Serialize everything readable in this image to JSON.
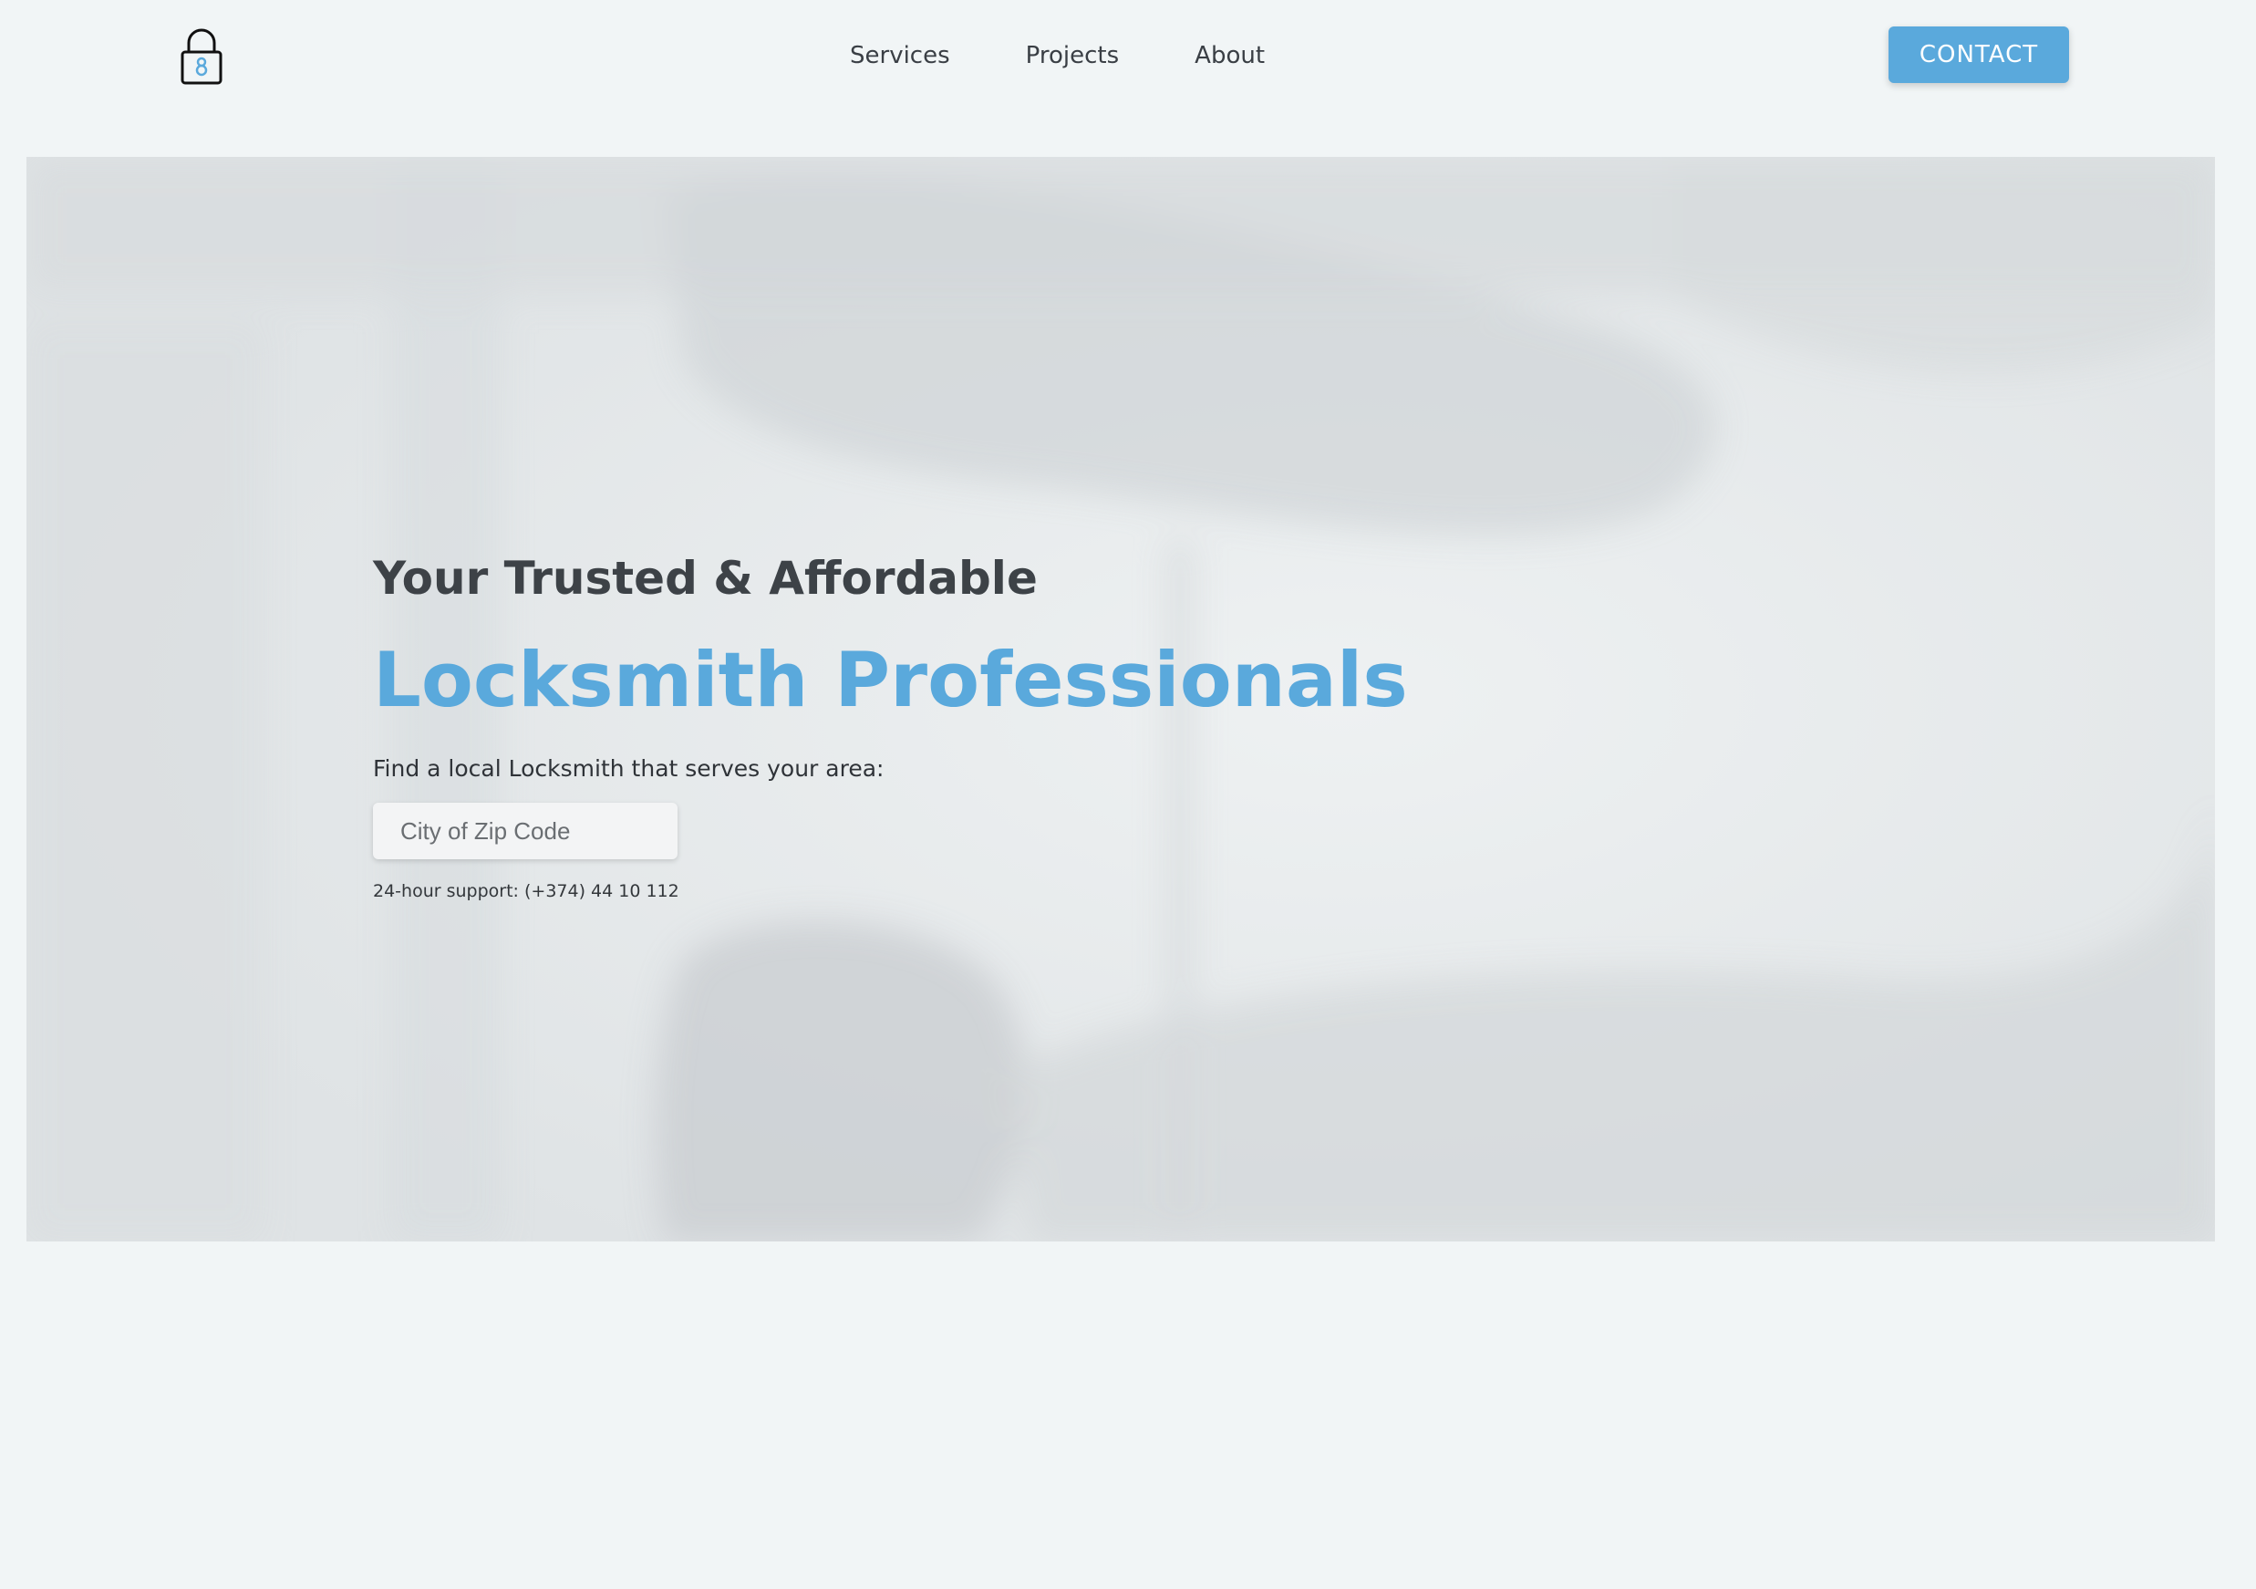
{
  "header": {
    "logo_icon": "padlock-icon",
    "nav": {
      "services": "Services",
      "projects": "Projects",
      "about": "About"
    },
    "contact_label": "CONTACT"
  },
  "hero": {
    "subtitle": "Your Trusted & Affordable",
    "title": "Locksmith Professionals",
    "find_text": "Find a local Locksmith that serves your area:",
    "search_placeholder": "City of Zip Code",
    "support_text": "24-hour support: (+374) 44 10 112"
  },
  "colors": {
    "accent": "#5aa9dc",
    "page_background": "#f1f5f6",
    "heading_text": "#3d4247"
  }
}
